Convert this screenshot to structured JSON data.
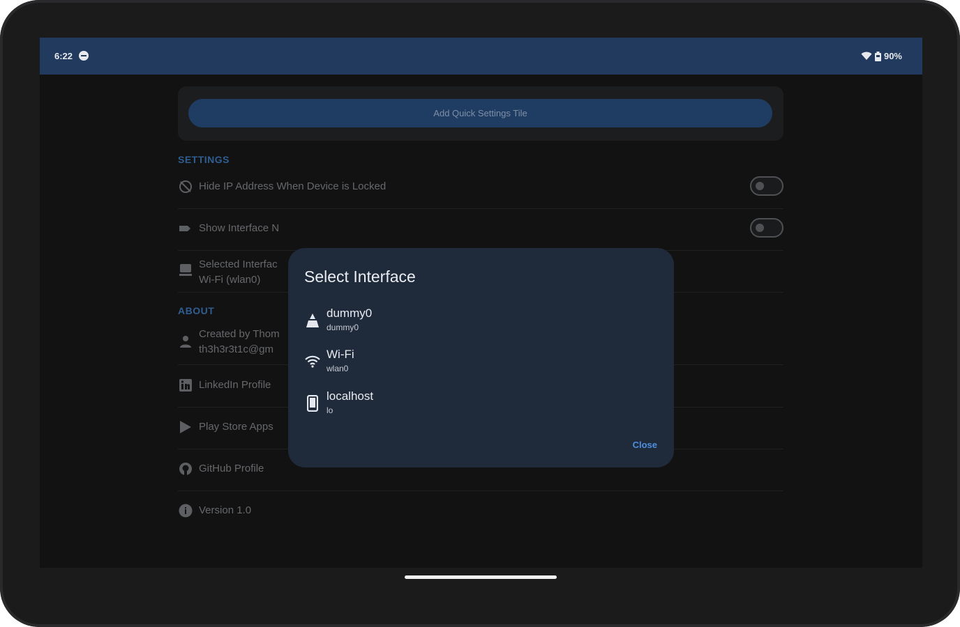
{
  "status_bar": {
    "time": "6:22",
    "battery": "90%",
    "icons": [
      "dnd-icon",
      "wifi-icon",
      "battery-icon"
    ]
  },
  "quick_settings": {
    "button_label": "Add Quick Settings Tile"
  },
  "settings": {
    "section_title": "SETTINGS",
    "items": [
      {
        "label": "Hide IP Address When Device is Locked",
        "icon": "hide-icon",
        "toggle": false
      },
      {
        "label": "Show Interface N",
        "icon": "label-icon",
        "toggle": false
      },
      {
        "label": "Selected Interfac",
        "sublabel": "Wi-Fi (wlan0)",
        "icon": "device-icon"
      }
    ]
  },
  "about": {
    "section_title": "ABOUT",
    "items": [
      {
        "label": "Created by Thom",
        "sublabel": "th3h3r3t1c@gm",
        "icon": "person-icon"
      },
      {
        "label": "LinkedIn Profile",
        "icon": "linkedin-icon"
      },
      {
        "label": "Play Store Apps",
        "icon": "play-icon"
      },
      {
        "label": "GitHub Profile",
        "icon": "github-icon"
      },
      {
        "label": "Version 1.0",
        "icon": "info-icon"
      }
    ]
  },
  "dialog": {
    "title": "Select Interface",
    "options": [
      {
        "name": "dummy0",
        "sub": "dummy0",
        "icon": "person-icon"
      },
      {
        "name": "Wi-Fi",
        "sub": "wlan0",
        "icon": "wifi-icon"
      },
      {
        "name": "localhost",
        "sub": "lo",
        "icon": "phone-icon"
      }
    ],
    "close_label": "Close"
  },
  "colors": {
    "accent": "#4e8fe0",
    "statusbar": "#223a5e",
    "dialog": "#1f2a3a"
  }
}
